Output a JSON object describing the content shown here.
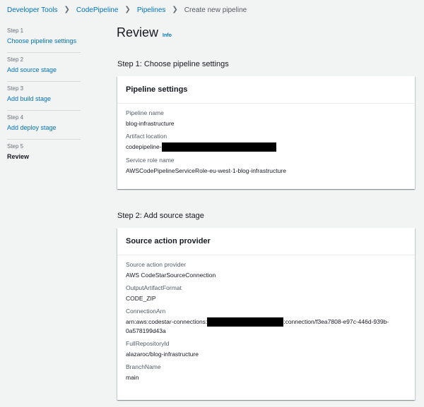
{
  "breadcrumb": {
    "items": [
      "Developer Tools",
      "CodePipeline",
      "Pipelines"
    ],
    "current": "Create new pipeline"
  },
  "steps": [
    {
      "number": "Step 1",
      "label": "Choose pipeline settings"
    },
    {
      "number": "Step 2",
      "label": "Add source stage"
    },
    {
      "number": "Step 3",
      "label": "Add build stage"
    },
    {
      "number": "Step 4",
      "label": "Add deploy stage"
    },
    {
      "number": "Step 5",
      "label": "Review"
    }
  ],
  "page": {
    "title": "Review",
    "info": "Info"
  },
  "sections": {
    "step1_title": "Step 1: Choose pipeline settings",
    "step2_title": "Step 2: Add source stage"
  },
  "pipeline_settings": {
    "header": "Pipeline settings",
    "pipeline_name_label": "Pipeline name",
    "pipeline_name": "blog-infrastructure",
    "artifact_location_label": "Artifact location",
    "artifact_location_prefix": "codepipeline-",
    "service_role_label": "Service role name",
    "service_role": "AWSCodePipelineServiceRole-eu-west-1-blog-infrastructure"
  },
  "source_action": {
    "header": "Source action provider",
    "provider_label": "Source action provider",
    "provider": "AWS CodeStarSourceConnection",
    "output_format_label": "OutputArtifactFormat",
    "output_format": "CODE_ZIP",
    "connection_arn_label": "ConnectionArn",
    "connection_arn_prefix": "arn:aws:codestar-connections:",
    "connection_arn_suffix": ":connection/f3ea7808-e97c-446d-939b-0a578199d43a",
    "repo_label": "FullRepositoryId",
    "repo": "alazaroc/blog-infrastructure",
    "branch_label": "BranchName",
    "branch": "main"
  },
  "colors": {
    "link": "#0073bb",
    "background": "#f2f3f3",
    "redaction": "#000000"
  },
  "icons": {
    "breadcrumb_separator": "chevron-right-icon"
  }
}
